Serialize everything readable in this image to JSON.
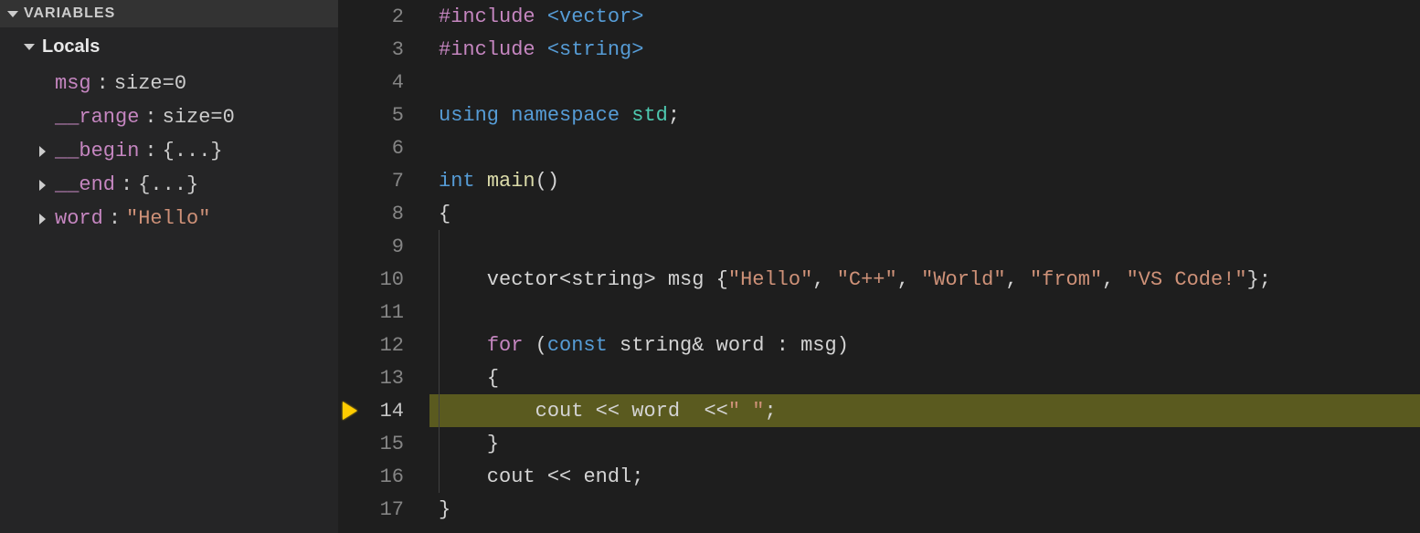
{
  "sidebar": {
    "section_title": "VARIABLES",
    "scope_label": "Locals",
    "vars": [
      {
        "name": "msg",
        "value": "size=0",
        "expandable": false,
        "valueClass": ""
      },
      {
        "name": "__range",
        "value": "size=0",
        "expandable": false,
        "valueClass": ""
      },
      {
        "name": "__begin",
        "value": "{...}",
        "expandable": true,
        "valueClass": ""
      },
      {
        "name": "__end",
        "value": "{...}",
        "expandable": true,
        "valueClass": ""
      },
      {
        "name": "word",
        "value": "\"Hello\"",
        "expandable": true,
        "valueClass": "string"
      }
    ]
  },
  "editor": {
    "current_line": 14,
    "lines": [
      {
        "n": 2,
        "tokens": [
          [
            "tok-preproc",
            "#include "
          ],
          [
            "tok-keyword",
            "<vector>"
          ]
        ]
      },
      {
        "n": 3,
        "tokens": [
          [
            "tok-preproc",
            "#include "
          ],
          [
            "tok-keyword",
            "<string>"
          ]
        ]
      },
      {
        "n": 4,
        "tokens": []
      },
      {
        "n": 5,
        "tokens": [
          [
            "tok-keyword",
            "using "
          ],
          [
            "tok-keyword",
            "namespace "
          ],
          [
            "tok-type",
            "std"
          ],
          [
            "tok-punct",
            ";"
          ]
        ]
      },
      {
        "n": 6,
        "tokens": []
      },
      {
        "n": 7,
        "tokens": [
          [
            "tok-keyword",
            "int "
          ],
          [
            "tok-func",
            "main"
          ],
          [
            "tok-punct",
            "()"
          ]
        ]
      },
      {
        "n": 8,
        "tokens": [
          [
            "tok-punct",
            "{"
          ]
        ]
      },
      {
        "n": 9,
        "tokens": [],
        "indent": 1
      },
      {
        "n": 10,
        "indent": 1,
        "tokens": [
          [
            "tok-ident",
            "    vector"
          ],
          [
            "tok-punct",
            "<"
          ],
          [
            "tok-ident",
            "string"
          ],
          [
            "tok-punct",
            "> "
          ],
          [
            "tok-ident",
            "msg "
          ],
          [
            "tok-punct",
            "{"
          ],
          [
            "tok-string",
            "\"Hello\""
          ],
          [
            "tok-punct",
            ", "
          ],
          [
            "tok-string",
            "\"C++\""
          ],
          [
            "tok-punct",
            ", "
          ],
          [
            "tok-string",
            "\"World\""
          ],
          [
            "tok-punct",
            ", "
          ],
          [
            "tok-string",
            "\"from\""
          ],
          [
            "tok-punct",
            ", "
          ],
          [
            "tok-string",
            "\"VS Code!\""
          ],
          [
            "tok-punct",
            "};"
          ]
        ]
      },
      {
        "n": 11,
        "tokens": [],
        "indent": 1
      },
      {
        "n": 12,
        "indent": 1,
        "tokens": [
          [
            "tok-ident",
            "    "
          ],
          [
            "tok-preproc",
            "for "
          ],
          [
            "tok-punct",
            "("
          ],
          [
            "tok-keyword",
            "const "
          ],
          [
            "tok-ident",
            "string"
          ],
          [
            "tok-op",
            "& "
          ],
          [
            "tok-ident",
            "word "
          ],
          [
            "tok-punct",
            ": "
          ],
          [
            "tok-ident",
            "msg"
          ],
          [
            "tok-punct",
            ")"
          ]
        ]
      },
      {
        "n": 13,
        "indent": 1,
        "tokens": [
          [
            "tok-ident",
            "    "
          ],
          [
            "tok-punct",
            "{"
          ]
        ]
      },
      {
        "n": 14,
        "indent": 2,
        "tokens": [
          [
            "tok-ident",
            "        cout "
          ],
          [
            "tok-op",
            "<< "
          ],
          [
            "tok-ident",
            "word  "
          ],
          [
            "tok-op",
            "<<"
          ],
          [
            "tok-string",
            "\" \""
          ],
          [
            "tok-punct",
            ";"
          ]
        ]
      },
      {
        "n": 15,
        "indent": 1,
        "tokens": [
          [
            "tok-ident",
            "    "
          ],
          [
            "tok-punct",
            "}"
          ]
        ]
      },
      {
        "n": 16,
        "indent": 1,
        "tokens": [
          [
            "tok-ident",
            "    cout "
          ],
          [
            "tok-op",
            "<< "
          ],
          [
            "tok-ident",
            "endl"
          ],
          [
            "tok-punct",
            ";"
          ]
        ]
      },
      {
        "n": 17,
        "tokens": [
          [
            "tok-punct",
            "}"
          ]
        ]
      }
    ]
  }
}
